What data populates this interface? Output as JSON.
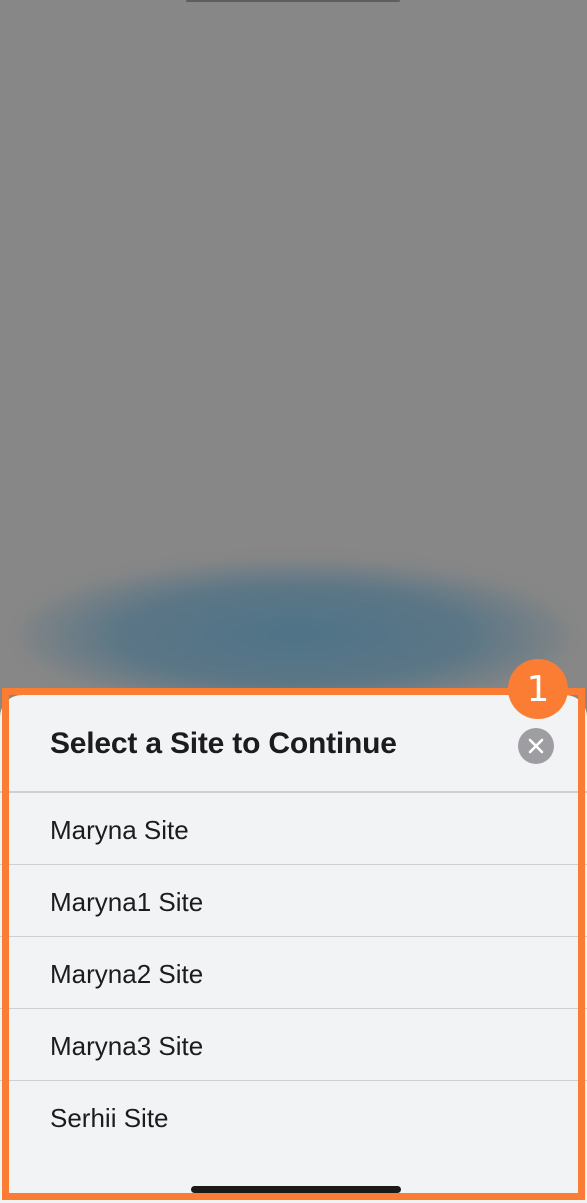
{
  "sheet": {
    "title": "Select a Site to Continue",
    "close_icon": "close-icon",
    "sites": [
      {
        "label": "Maryna Site"
      },
      {
        "label": "Maryna1 Site"
      },
      {
        "label": "Maryna2 Site"
      },
      {
        "label": "Maryna3 Site"
      },
      {
        "label": "Serhii Site"
      }
    ]
  },
  "annotation": {
    "step_number": "1",
    "color": "#fb7d33"
  },
  "colors": {
    "backdrop": "#878787",
    "sheet_background": "#f2f3f5",
    "text": "#1c1c1e",
    "divider": "#cfd0d3",
    "close_button": "#9e9ea2"
  }
}
